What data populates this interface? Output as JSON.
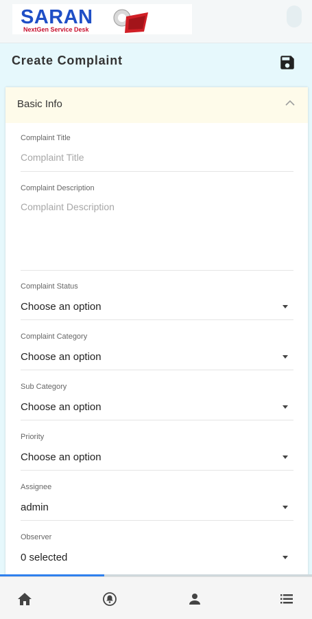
{
  "header": {
    "logo_text": "SARAN",
    "logo_tagline": "NextGen Service Desk"
  },
  "page": {
    "title": "Create Complaint"
  },
  "panel": {
    "title": "Basic Info",
    "fields": {
      "title": {
        "label": "Complaint Title",
        "placeholder": "Complaint Title"
      },
      "description": {
        "label": "Complaint Description",
        "placeholder": "Complaint Description"
      },
      "status": {
        "label": "Complaint Status",
        "value": "Choose an option"
      },
      "category": {
        "label": "Complaint Category",
        "value": "Choose an option"
      },
      "sub_category": {
        "label": "Sub Category",
        "value": "Choose an option"
      },
      "priority": {
        "label": "Priority",
        "value": "Choose an option"
      },
      "assignee": {
        "label": "Assignee",
        "value": "admin"
      },
      "observer": {
        "label": "Observer",
        "value": "0 selected"
      }
    }
  },
  "icons": {
    "save": "floppy-disk-icon",
    "collapse": "chevron-up-icon",
    "nav_home": "home-icon",
    "nav_alerts": "alert-bell-icon",
    "nav_profile": "person-icon",
    "nav_menu": "list-menu-icon"
  },
  "colors": {
    "brand_blue": "#1f4fc6",
    "brand_red": "#c8102e",
    "page_bg": "#e6f8fc",
    "panel_header_bg": "#fefbea",
    "scroll_accent": "#2f80ed"
  }
}
